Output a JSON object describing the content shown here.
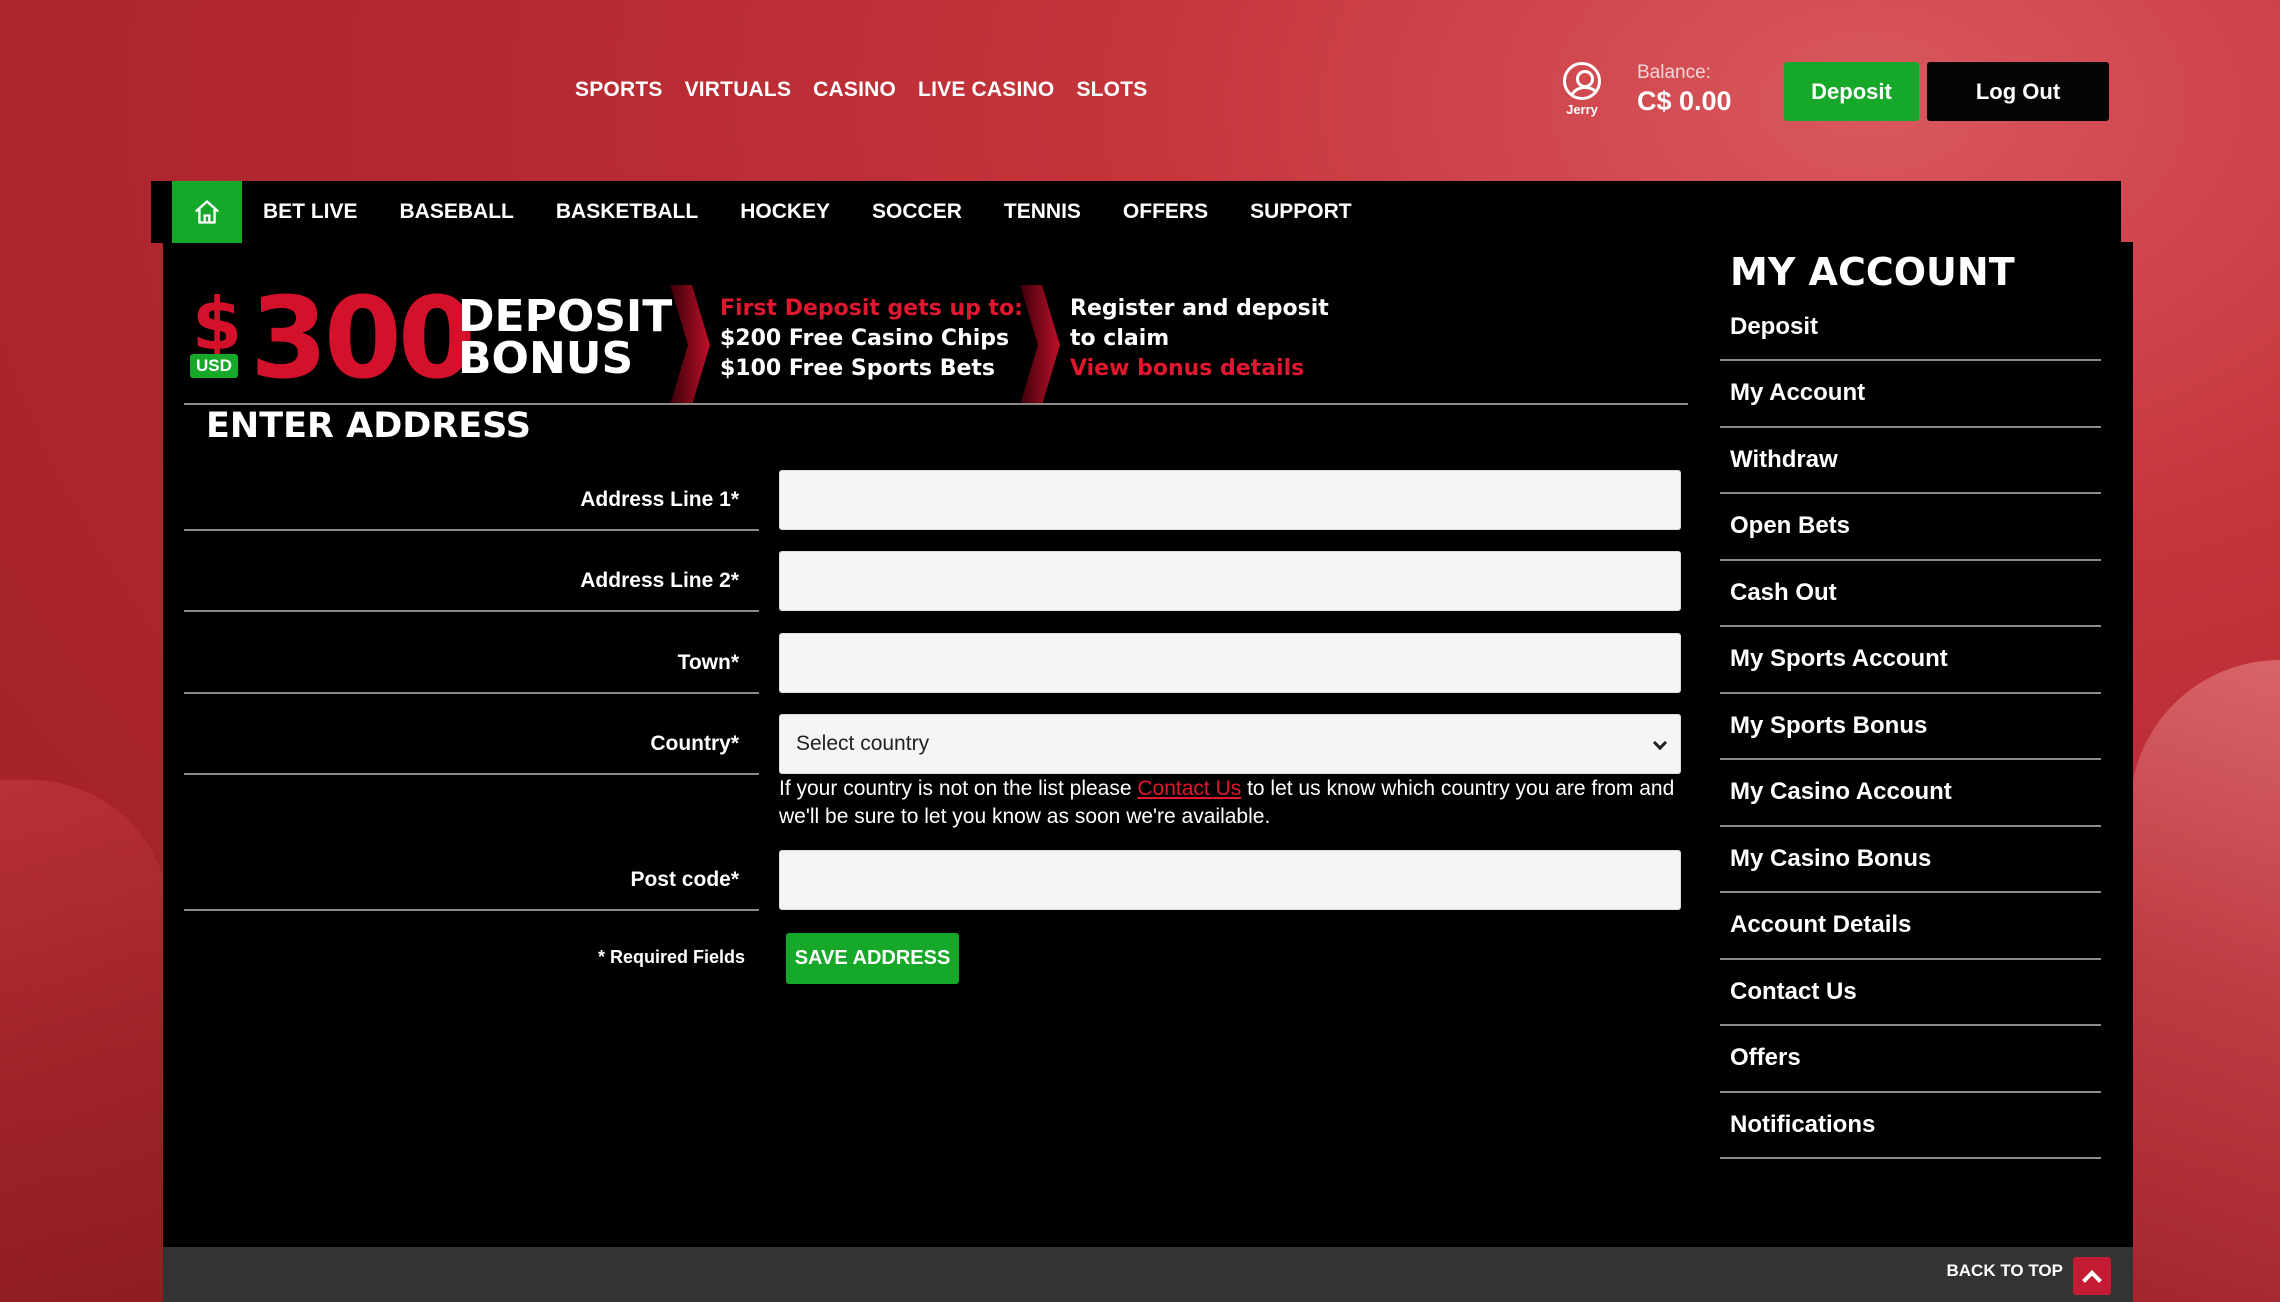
{
  "topnav": [
    "SPORTS",
    "VIRTUALS",
    "CASINO",
    "LIVE CASINO",
    "SLOTS"
  ],
  "user": {
    "name": "Jerry",
    "balance_label": "Balance:",
    "balance_value": "C$ 0.00"
  },
  "buttons": {
    "deposit": "Deposit",
    "logout": "Log Out",
    "save": "SAVE ADDRESS"
  },
  "subnav": [
    "BET LIVE",
    "BASEBALL",
    "BASKETBALL",
    "HOCKEY",
    "SOCCER",
    "TENNIS",
    "OFFERS",
    "SUPPORT"
  ],
  "banner": {
    "currency_symbol": "$",
    "currency_code": "USD",
    "amount": "300",
    "title_line1": "DEPOSIT",
    "title_line2": "BONUS",
    "col1_line1": "First Deposit gets up to:",
    "col1_line2": "$200 Free Casino Chips",
    "col1_line3": "$100 Free Sports Bets",
    "col2_line1": "Register and deposit",
    "col2_line2": "to claim",
    "col2_link": "View bonus details"
  },
  "form": {
    "title": "ENTER ADDRESS",
    "fields": [
      {
        "label": "Address Line 1*",
        "value": ""
      },
      {
        "label": "Address Line 2*",
        "value": ""
      },
      {
        "label": "Town*",
        "value": ""
      },
      {
        "label": "Country*",
        "value": "Select country"
      },
      {
        "label": "Post code*",
        "value": ""
      }
    ],
    "country_note_before": "If your country is not on the list please ",
    "country_note_link": "Contact Us",
    "country_note_after": " to let us know which country you are from and we'll be sure to let you know as soon we're available.",
    "required_note": "* Required Fields"
  },
  "account": {
    "title": "MY ACCOUNT",
    "items": [
      "Deposit",
      "My Account",
      "Withdraw",
      "Open Bets",
      "Cash Out",
      "My Sports Account",
      "My Sports Bonus",
      "My Casino Account",
      "My Casino Bonus",
      "Account Details",
      "Contact Us",
      "Offers",
      "Notifications"
    ]
  },
  "footer": {
    "back_to_top": "BACK TO TOP"
  },
  "colors": {
    "accent_green": "#16a829",
    "accent_red": "#d4112b",
    "panel": "#000000"
  },
  "icons": {
    "home": "home-icon",
    "user": "user-icon",
    "select": "chevron-down-icon",
    "back_to_top": "chevron-up-icon"
  }
}
